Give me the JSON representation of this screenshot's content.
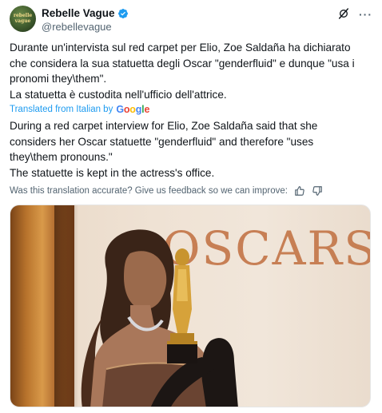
{
  "author": {
    "display_name": "Rebelle Vague",
    "handle": "@rebellevague",
    "avatar_text": "rebelle vague"
  },
  "tweet": {
    "original_lines": [
      "Durante un'intervista sul red carpet per Elio, Zoe Saldaña ha dichiarato",
      "che considera la sua statuetta degli Oscar \"genderfluid\" e dunque \"usa i",
      "pronomi they\\them\".",
      "La statuetta è custodita nell'ufficio dell'attrice."
    ],
    "translated_by": "Translated from Italian by",
    "translation_provider": "Google",
    "translated_lines": [
      "During a red carpet interview for Elio, Zoe Saldaña said that she",
      "considers her Oscar statuette \"genderfluid\" and therefore \"uses",
      "they\\them pronouns.\"",
      "The statuette is kept in the actress's office."
    ],
    "feedback_prompt": "Was this translation accurate? Give us feedback so we can improve:"
  },
  "media": {
    "backdrop_text": "OSCARS"
  },
  "colors": {
    "link": "#1d9bf0",
    "verified": "#1d9bf0",
    "muted": "#536471",
    "oscars_lettering": "#c57a4e"
  },
  "icons": [
    "verified-badge-icon",
    "grok-icon",
    "more-icon",
    "thumbs-up-icon",
    "thumbs-down-icon"
  ]
}
